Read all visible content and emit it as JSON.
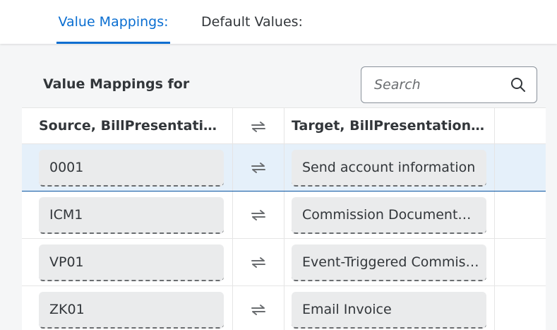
{
  "tabs": {
    "value_mappings": "Value Mappings:",
    "default_values": "Default Values:"
  },
  "section": {
    "title": "Value Mappings for"
  },
  "search": {
    "placeholder": "Search"
  },
  "table": {
    "headers": {
      "source": "Source, BillPresentationMedium",
      "target": "Target, BillPresentationMedium"
    },
    "rows": [
      {
        "source": "0001",
        "target": "Send account information",
        "selected": true
      },
      {
        "source": "ICM1",
        "target": "Commission Documentation"
      },
      {
        "source": "VP01",
        "target": "Event-Triggered Commission"
      },
      {
        "source": "ZK01",
        "target": "Email Invoice"
      }
    ]
  },
  "colors": {
    "accent": "#0a6ed1",
    "selected_row": "#e5f0fa",
    "field_bg": "#eaebec"
  },
  "icons": {
    "search": "search-icon",
    "swap": "swap-arrows-icon"
  }
}
